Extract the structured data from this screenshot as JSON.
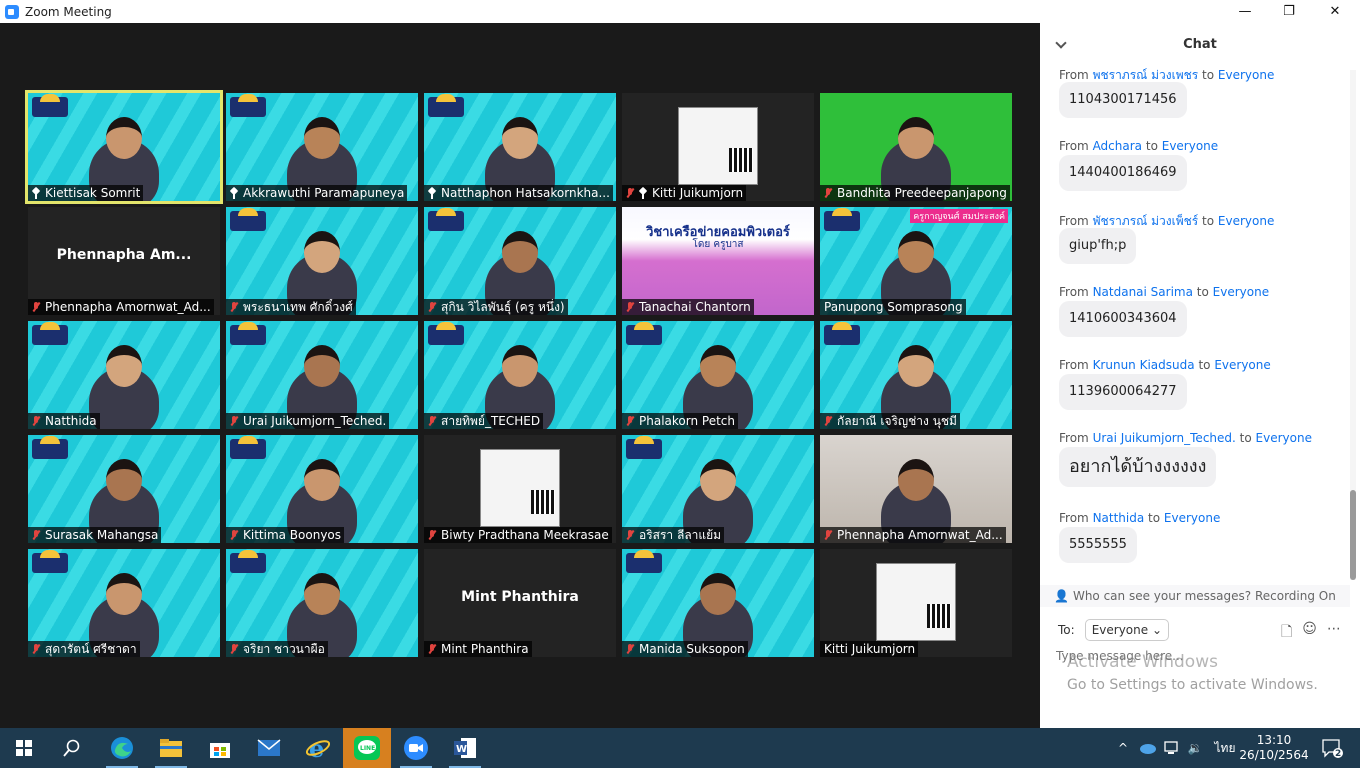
{
  "window": {
    "title": "Zoom Meeting",
    "controls": [
      "—",
      "❐",
      "✕"
    ]
  },
  "participants": [
    {
      "name": "Kiettisak Somrit",
      "icon": "pin",
      "active": true,
      "bg": "cyan"
    },
    {
      "name": "Akkrawuthi Paramapuneya",
      "icon": "pin",
      "bg": "cyan"
    },
    {
      "name": "Natthaphon Hatsakornkha...",
      "icon": "pin",
      "bg": "cyan"
    },
    {
      "name": "Kitti Juikumjorn",
      "icon": "muted+pin",
      "bg": "dark"
    },
    {
      "name": "Bandhita Preedeepanjapong",
      "icon": "muted",
      "bg": "green"
    },
    {
      "name": "Phennapha Amornwat_Ad...",
      "icon": "muted",
      "bg": "dark",
      "center_name": "Phennapha  Am..."
    },
    {
      "name": "พระธนาเทพ ศักดิ์วงศ์",
      "icon": "muted",
      "bg": "cyan"
    },
    {
      "name": "สุกิน วิไลพันธุ์ (ครู หนึ่ง)",
      "icon": "muted",
      "bg": "cyan"
    },
    {
      "name": "Tanachai Chantorn",
      "icon": "muted",
      "bg": "pink",
      "slide_title": "วิชาเครือข่ายคอมพิวเตอร์",
      "slide_sub": "โดย ครูบาส"
    },
    {
      "name": "Panupong Somprasong",
      "icon": "none",
      "bg": "cyan",
      "caption": "ครูกาญจนศ์ สมประสงค์"
    },
    {
      "name": "Natthida",
      "icon": "muted",
      "bg": "cyan"
    },
    {
      "name": "Urai Juikumjorn_Teched.",
      "icon": "muted",
      "bg": "cyan"
    },
    {
      "name": "สายทิพย์_TECHED",
      "icon": "muted",
      "bg": "cyan"
    },
    {
      "name": "Phalakorn Petch",
      "icon": "muted",
      "bg": "cyan"
    },
    {
      "name": "กัลยาณี เจริญช่าง นุชมี",
      "icon": "muted",
      "bg": "cyan"
    },
    {
      "name": "Surasak Mahangsa",
      "icon": "muted",
      "bg": "cyan"
    },
    {
      "name": "Kittima Boonyos",
      "icon": "muted",
      "bg": "cyan"
    },
    {
      "name": "Biwty Pradthana Meekrasae",
      "icon": "muted",
      "bg": "dark"
    },
    {
      "name": "อริสรา ลีลาแย้ม",
      "icon": "muted",
      "bg": "cyan"
    },
    {
      "name": "Phennapha Amornwat_Ad...",
      "icon": "muted",
      "bg": "room"
    },
    {
      "name": "สุดารัตน์ ศรีชาดา",
      "icon": "muted",
      "bg": "cyan"
    },
    {
      "name": "จริยา ชาวนาผือ",
      "icon": "muted",
      "bg": "cyan"
    },
    {
      "name": "Mint Phanthira",
      "icon": "muted",
      "bg": "dark",
      "center_name": "Mint Phanthira"
    },
    {
      "name": "Manida Suksopon",
      "icon": "muted",
      "bg": "cyan"
    },
    {
      "name": "Kitti Juikumjorn",
      "icon": "none",
      "bg": "dark"
    }
  ],
  "chat": {
    "title": "Chat",
    "from_word": "From",
    "to_word": "to",
    "messages": [
      {
        "sender": "พชราภรณ์ ม่วงเพชร",
        "recipient": "Everyone",
        "text": "1104300171456"
      },
      {
        "sender": "Adchara",
        "recipient": "Everyone",
        "text": "1440400186469"
      },
      {
        "sender": "พัชราภรณ์ ม่วงเพ็ชร์",
        "recipient": "Everyone",
        "text": "giup'fh;p"
      },
      {
        "sender": "Natdanai Sarima",
        "recipient": "Everyone",
        "text": "1410600343604"
      },
      {
        "sender": "Krunun Kiadsuda",
        "recipient": "Everyone",
        "text": "1139600064277"
      },
      {
        "sender": "Urai Juikumjorn_Teched.",
        "recipient": "Everyone",
        "text": "อยากได้บ้างงงงงง"
      },
      {
        "sender": "Natthida",
        "recipient": "Everyone",
        "text": "5555555"
      }
    ],
    "notice": "Who can see your messages? Recording On",
    "to_label": "To:",
    "to_value": "Everyone",
    "input_placeholder": "Type message here..."
  },
  "activation": {
    "line1": "Activate Windows",
    "line2": "Go to Settings to activate Windows."
  },
  "taskbar": {
    "apps": [
      "windows-start",
      "search",
      "edge",
      "file-explorer",
      "store",
      "mail",
      "internet-explorer",
      "line",
      "zoom",
      "word"
    ],
    "active_app": "line",
    "language": "ไทย",
    "time": "13:10",
    "date": "26/10/2564",
    "notification_count": "2"
  },
  "colors": {
    "accent": "#0e72ed",
    "muted_icon": "#e0443f",
    "active_speaker": "#e3e56b",
    "taskbar": "#1e3a4f"
  }
}
